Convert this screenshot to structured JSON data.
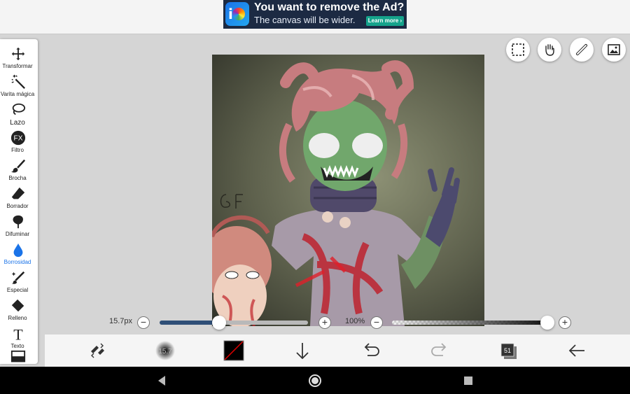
{
  "ad": {
    "headline": "You want to remove the Ad?",
    "subline": "The canvas will be wider.",
    "button": "Learn more ›"
  },
  "tools": [
    {
      "name": "Transformar",
      "icon": "move-icon"
    },
    {
      "name": "Varita mágica",
      "icon": "magic-wand-icon"
    },
    {
      "name": "Lazo",
      "icon": "lasso-icon"
    },
    {
      "name": "Filtro",
      "icon": "fx-icon"
    },
    {
      "name": "Brocha",
      "icon": "brush-icon"
    },
    {
      "name": "Borrador",
      "icon": "eraser-icon"
    },
    {
      "name": "Difuminar",
      "icon": "smudge-icon"
    },
    {
      "name": "Borrosidad",
      "icon": "blur-drop-icon",
      "active": true
    },
    {
      "name": "Especial",
      "icon": "special-brush-icon"
    },
    {
      "name": "Relleno",
      "icon": "fill-icon"
    },
    {
      "name": "Texto",
      "icon": "text-icon"
    }
  ],
  "fx_glyph": "FX",
  "text_glyph": "T",
  "brush_size": {
    "label": "15.7px",
    "value": 15.7
  },
  "opacity": {
    "label": "100%",
    "value": 100
  },
  "brush_preview_label": "15.7",
  "layers_count": "51",
  "colors": {
    "accent": "#1a73e8",
    "primary_color": "#000000"
  }
}
